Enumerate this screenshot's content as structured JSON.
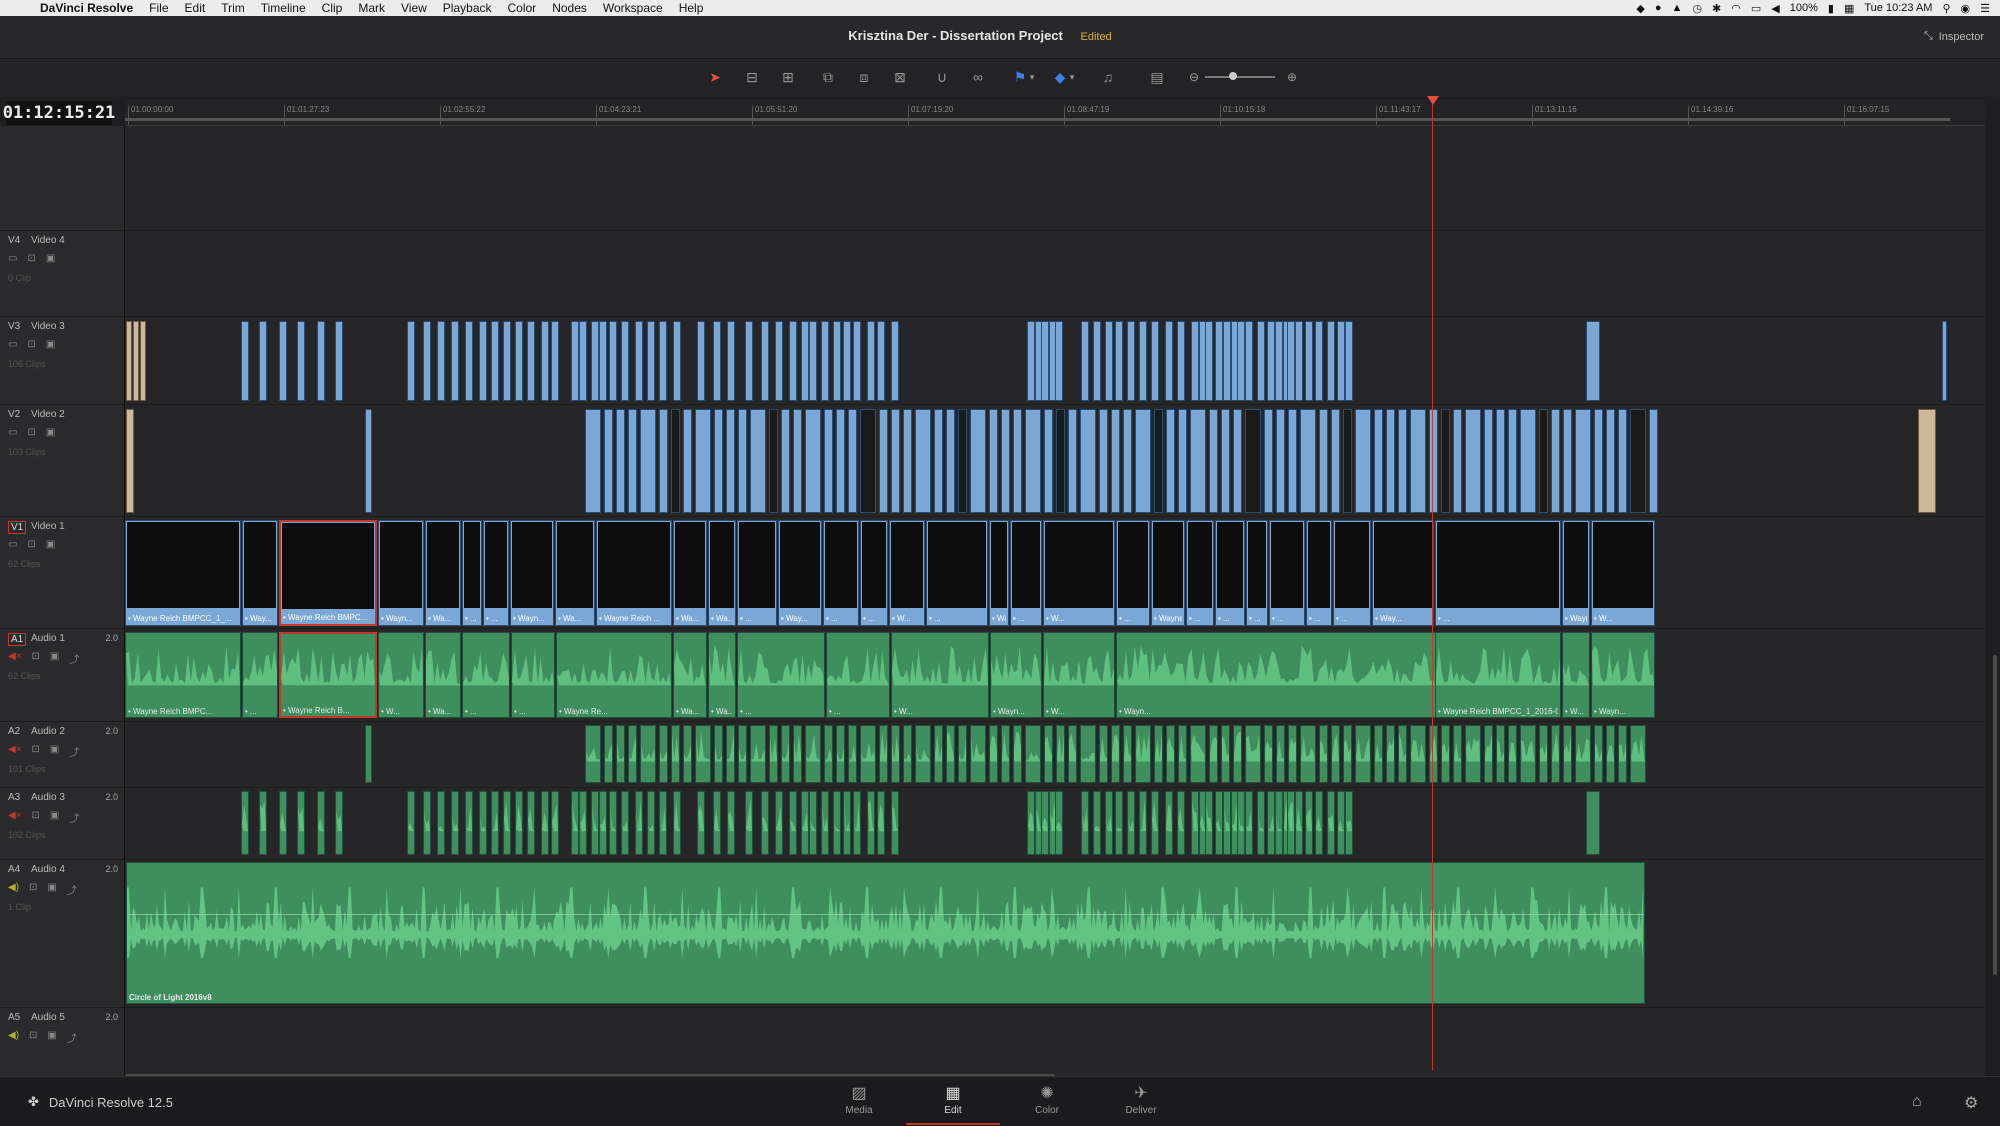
{
  "menubar": {
    "app": "DaVinci Resolve",
    "items": [
      "File",
      "Edit",
      "Trim",
      "Timeline",
      "Clip",
      "Mark",
      "View",
      "Playback",
      "Color",
      "Nodes",
      "Workspace",
      "Help"
    ],
    "battery": "100%",
    "clock": "Tue 10:23 AM"
  },
  "titlebar": {
    "project": "Krisztina Der - Dissertation Project",
    "status": "Edited",
    "inspector": "Inspector"
  },
  "timecode": "01:12:15:21",
  "ruler": [
    "01:00:00:00",
    "01:01:27:23",
    "01:02:55:22",
    "01:04:23:21",
    "01:05:51:20",
    "01:07:19:20",
    "01:08:47:19",
    "01:10:15:18",
    "01:11:43:17",
    "01:13:11:16",
    "01:14:39:16",
    "01:16:07:15"
  ],
  "tracks": {
    "v4": {
      "id": "V4",
      "name": "Video 4",
      "clips": "0 Clip"
    },
    "v3": {
      "id": "V3",
      "name": "Video 3",
      "clips": "106 Clips"
    },
    "v2": {
      "id": "V2",
      "name": "Video 2",
      "clips": "103 Clips"
    },
    "v1": {
      "id": "V1",
      "name": "Video 1",
      "clips": "62 Clips"
    },
    "a1": {
      "id": "A1",
      "name": "Audio 1",
      "gain": "2.0",
      "clips": "62 Clips"
    },
    "a2": {
      "id": "A2",
      "name": "Audio 2",
      "gain": "2.0",
      "clips": "101 Clips"
    },
    "a3": {
      "id": "A3",
      "name": "Audio 3",
      "gain": "2.0",
      "clips": "102 Clips"
    },
    "a4": {
      "id": "A4",
      "name": "Audio 4",
      "gain": "2.0",
      "clips": "1 Clip"
    },
    "a5": {
      "id": "A5",
      "name": "Audio 5",
      "gain": "2.0"
    }
  },
  "v1_labels": [
    "• Wayne Reich BMPCC_1_...",
    "• Way...",
    "• Wayne Reich BMPC...",
    "• Wayn...",
    "• Wa...",
    "• ...",
    "• ...",
    "• Wayn...",
    "• Wa...",
    "• Wayne Reich ...",
    "• Wa...",
    "• Wa...",
    "• ...",
    "• Way...",
    "• ...",
    "• ...",
    "• W...",
    "• ...",
    "• Wayne R...",
    "• ...",
    "• W...",
    "• ...",
    "• Wayne R...",
    "• ...",
    "• ...",
    "• ...",
    "• ...",
    "• ...",
    "• ...",
    "• Way...",
    "• ...",
    "• Wayne Reich BMPCC_1_2016-05-06_0212_...",
    "• W...",
    "• Wayne R..."
  ],
  "a1_labels": [
    "• Wayne Reich BMPC...",
    "• ...",
    "• Wayne Reich B...",
    "• W...",
    "• Wa...",
    "• ...",
    "• ...",
    "• Wayne Re...",
    "• Wa...",
    "• Wa...",
    "• ...",
    "• ...",
    "• W...",
    "• Wayn...",
    "• W...",
    "• Wayn...",
    "• Wayne Reich BMPCC_1_2016-05-06_02...",
    "• W...",
    "• Wayn..."
  ],
  "a4_clip": "Circle of Light 2016v8",
  "pages": [
    {
      "label": "Media",
      "icon": "media-icon"
    },
    {
      "label": "Edit",
      "icon": "edit-icon"
    },
    {
      "label": "Color",
      "icon": "color-icon"
    },
    {
      "label": "Deliver",
      "icon": "deliver-icon"
    }
  ],
  "brand": "DaVinci Resolve 12.5",
  "colors": {
    "video_clip": "#7aa7d6",
    "audio_clip": "#3f8f5e",
    "playhead": "#c0392b",
    "edited": "#d6b33a"
  }
}
